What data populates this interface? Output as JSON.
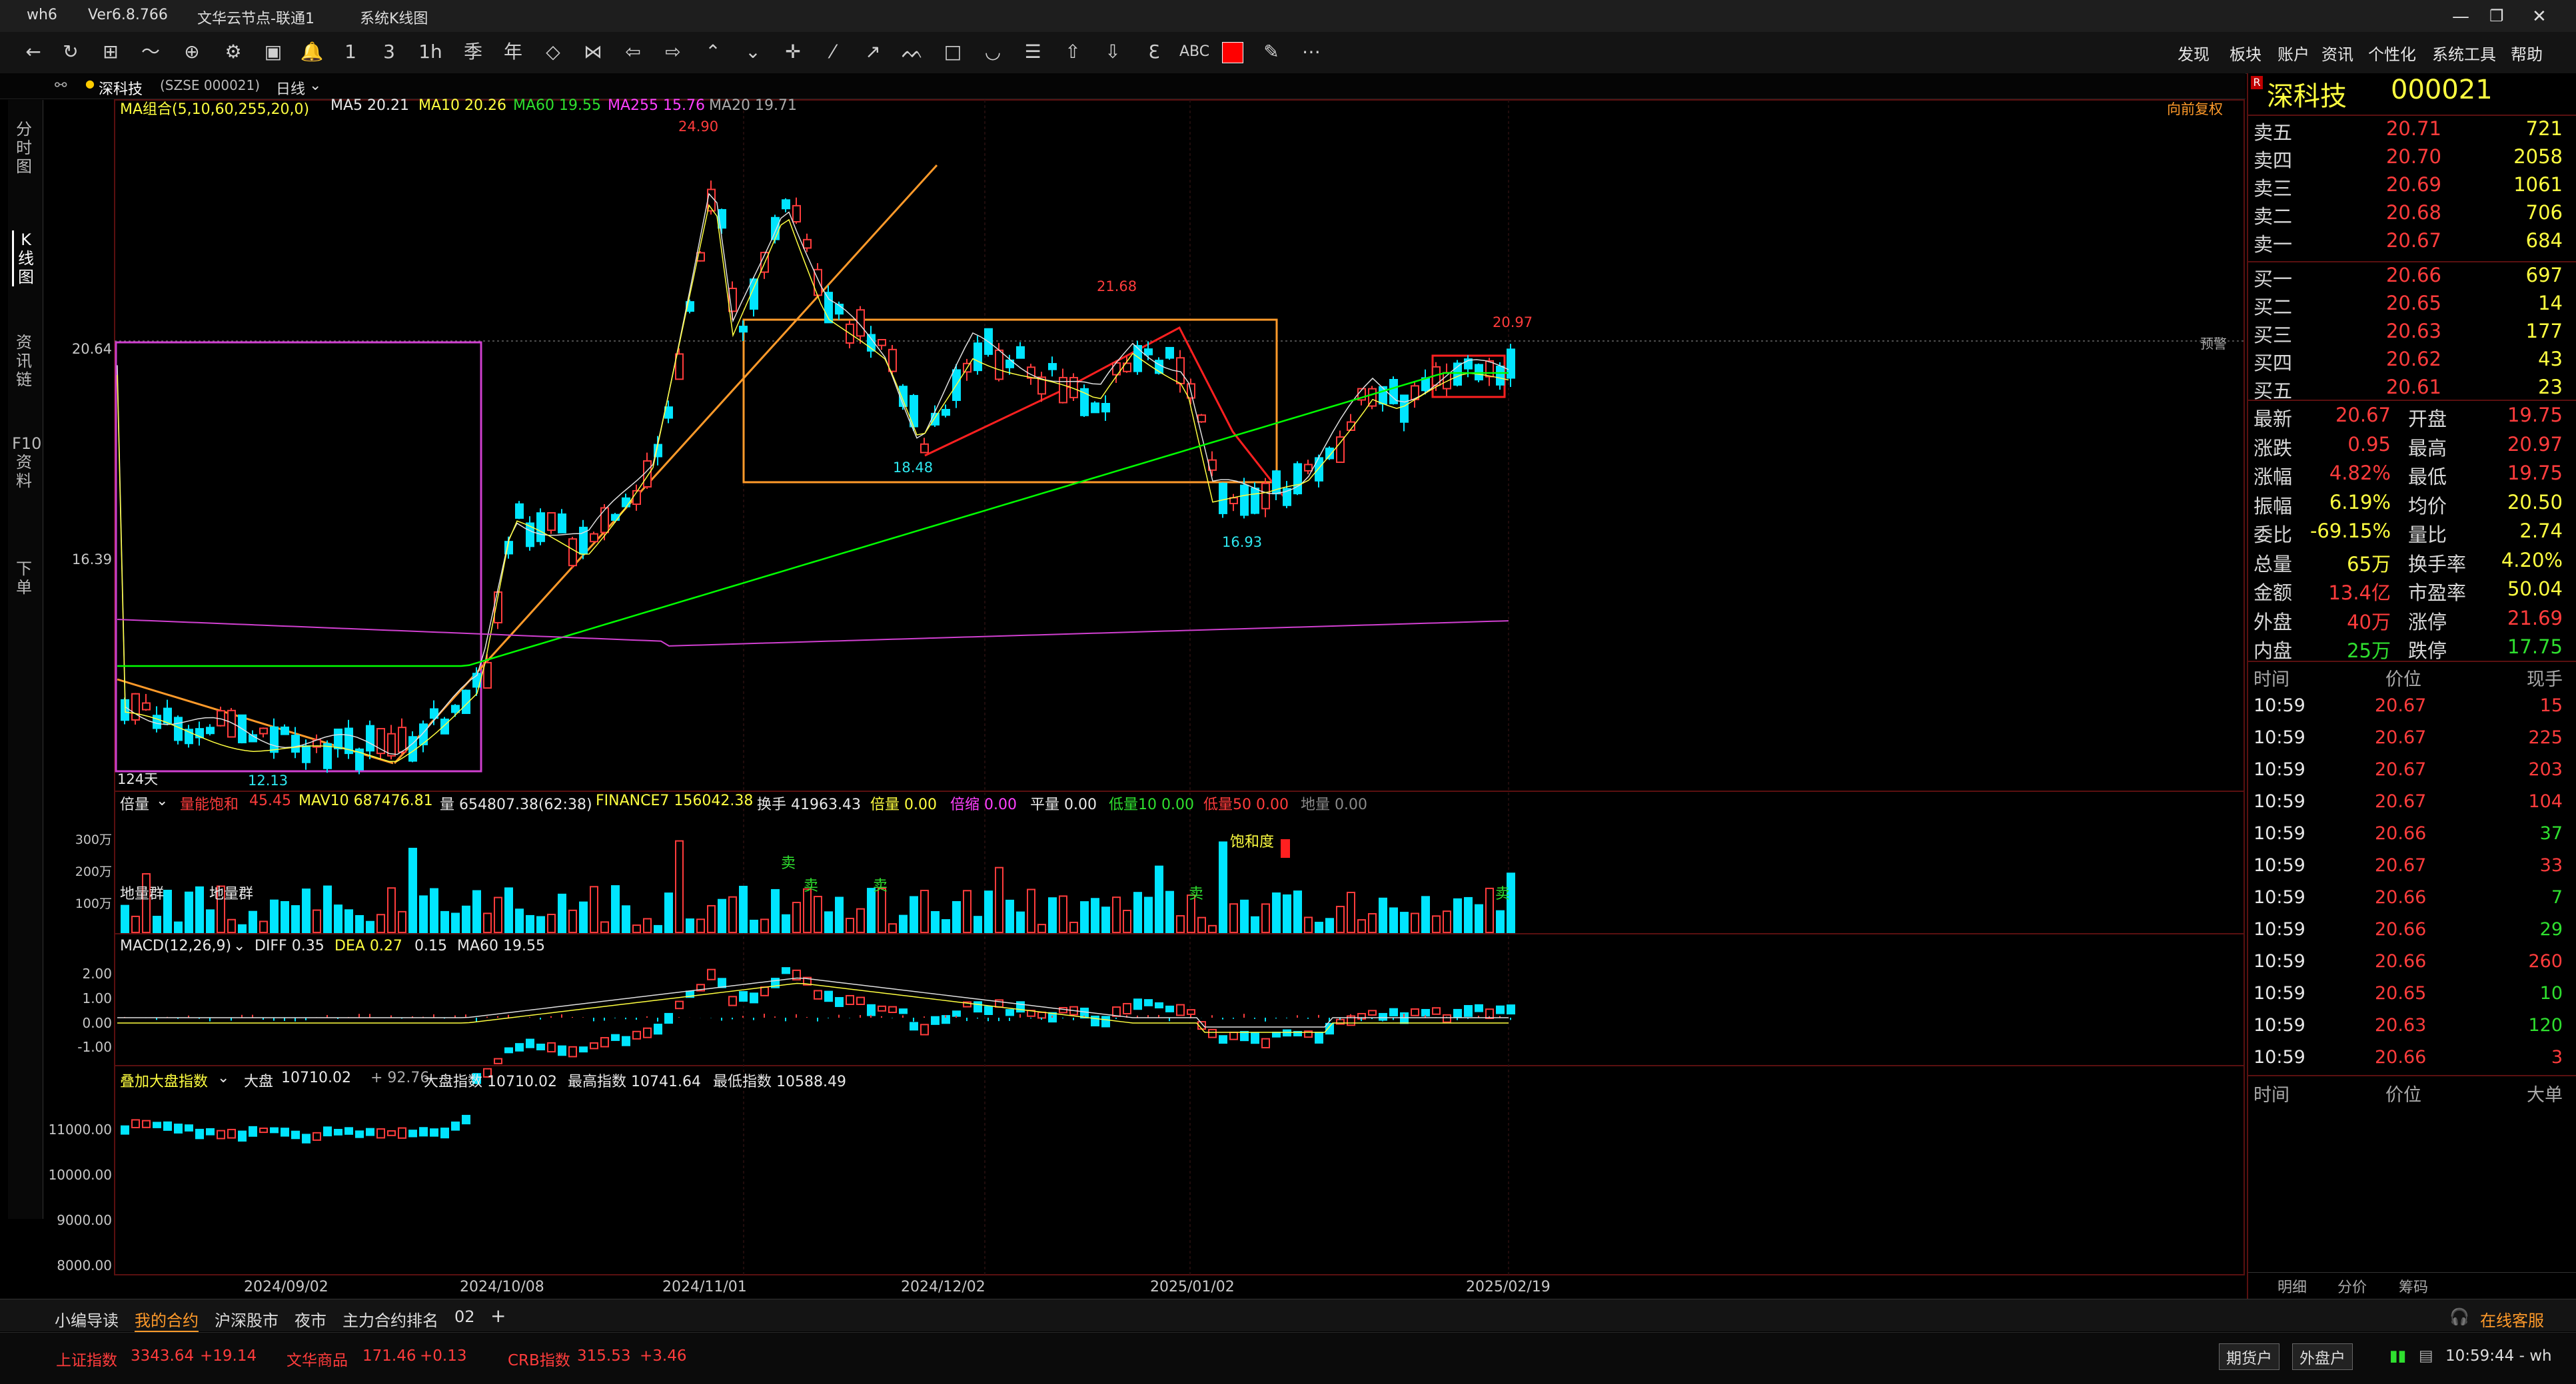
{
  "titlebar": {
    "app": "wh6",
    "version": "Ver6.8.766",
    "server": "文华云节点-联通1",
    "view": "系统K线图"
  },
  "menus": [
    "发现",
    "板块",
    "账户",
    "资讯",
    "个性化",
    "系统工具",
    "帮助"
  ],
  "infobar": {
    "name": "深科技",
    "code": "(SZSE 000021)",
    "period": "日线"
  },
  "left_tabs": [
    "分时图",
    "K线图",
    "资讯链",
    "F10资料",
    "下单"
  ],
  "ma_line": {
    "title": "MA组合(5,10,60,255,20,0)",
    "ma5": "MA5 20.21",
    "ma10": "MA10 20.26",
    "ma60": "MA60 19.55",
    "ma255": "MA255 15.76",
    "ma20": "MA20 19.71",
    "restore": "向前复权"
  },
  "price_labels": {
    "high": "24.90",
    "p2168": "21.68",
    "p2097": "20.97",
    "p1848": "18.48",
    "p1693": "16.93",
    "p1213": "12.13",
    "days": "124天",
    "y1": "20.64",
    "y2": "16.39",
    "warn": "预警"
  },
  "vol_line": {
    "title": "倍量",
    "vp": "量能饱和",
    "vp_val": "45.45",
    "mav": "MAV10 687476.81",
    "vol": "量 654807.38(62:38)",
    "fin": "FINANCE7 156042.38",
    "hs": "换手 41963.43",
    "bl": "倍量 0.00",
    "bs": "倍缩 0.00",
    "pl": "平量 0.00",
    "dl10": "低量10 0.00",
    "dl50": "低量50 0.00",
    "dil": "地量 0.00",
    "t1": "300万",
    "t2": "200万",
    "t3": "100万",
    "dlq1": "地量群",
    "dlq2": "地量群",
    "sell": "卖",
    "bhd": "饱和度"
  },
  "macd_line": {
    "title": "MACD(12,26,9)",
    "diff": "DIFF 0.35",
    "dea": "DEA 0.27",
    "val": "0.15",
    "ma60": "MA60 19.55",
    "t1": "2.00",
    "t2": "1.00",
    "t3": "0.00",
    "t4": "-1.00"
  },
  "idx_line": {
    "title": "叠加大盘指数",
    "dp": "大盘",
    "dp_val": "10710.02",
    "chg": "+ 92.76",
    "dpzs": "大盘指数 10710.02",
    "high": "最高指数 10741.64",
    "low": "最低指数 10588.49",
    "t1": "11000.00",
    "t2": "10000.00",
    "t3": "9000.00",
    "t4": "8000.00"
  },
  "dates": [
    "2024/09/02",
    "2024/10/08",
    "2024/11/01",
    "2024/12/02",
    "2025/01/02",
    "2025/02/19"
  ],
  "quote": {
    "name": "深科技",
    "code": "000021",
    "asks": [
      [
        "卖五",
        "20.71",
        "721"
      ],
      [
        "卖四",
        "20.70",
        "2058"
      ],
      [
        "卖三",
        "20.69",
        "1061"
      ],
      [
        "卖二",
        "20.68",
        "706"
      ],
      [
        "卖一",
        "20.67",
        "684"
      ]
    ],
    "bids": [
      [
        "买一",
        "20.66",
        "697"
      ],
      [
        "买二",
        "20.65",
        "14"
      ],
      [
        "买三",
        "20.63",
        "177"
      ],
      [
        "买四",
        "20.62",
        "43"
      ],
      [
        "买五",
        "20.61",
        "23"
      ]
    ],
    "stats": [
      [
        "最新",
        "20.67",
        "开盘",
        "19.75"
      ],
      [
        "涨跌",
        "0.95",
        "最高",
        "20.97"
      ],
      [
        "涨幅",
        "4.82%",
        "最低",
        "19.75"
      ],
      [
        "振幅",
        "6.19%",
        "均价",
        "20.50"
      ],
      [
        "委比",
        "-69.15%",
        "量比",
        "2.74"
      ],
      [
        "总量",
        "65万",
        "换手率",
        "4.20%"
      ],
      [
        "金额",
        "13.4亿",
        "市盈率",
        "50.04"
      ],
      [
        "外盘",
        "40万",
        "涨停",
        "21.69"
      ],
      [
        "内盘",
        "25万",
        "跌停",
        "17.75"
      ]
    ],
    "tick_headers": [
      "时间",
      "价位",
      "现手"
    ],
    "ticks": [
      [
        "10:59",
        "20.67",
        "15"
      ],
      [
        "10:59",
        "20.67",
        "225"
      ],
      [
        "10:59",
        "20.67",
        "203"
      ],
      [
        "10:59",
        "20.67",
        "104"
      ],
      [
        "10:59",
        "20.66",
        "37"
      ],
      [
        "10:59",
        "20.67",
        "33"
      ],
      [
        "10:59",
        "20.66",
        "7"
      ],
      [
        "10:59",
        "20.66",
        "29"
      ],
      [
        "10:59",
        "20.66",
        "260"
      ],
      [
        "10:59",
        "20.65",
        "10"
      ],
      [
        "10:59",
        "20.63",
        "120"
      ],
      [
        "10:59",
        "20.66",
        "3"
      ]
    ],
    "big_headers": [
      "时间",
      "价位",
      "大单"
    ],
    "bottom_tabs": [
      "明细",
      "分价",
      "筹码"
    ]
  },
  "bottom_tabs": [
    "小编导读",
    "我的合约",
    "沪深股市",
    "夜市",
    "主力合约排名",
    "02",
    "+"
  ],
  "service": "在线客服",
  "status": {
    "sh": "上证指数",
    "sh_val": "3343.64",
    "sh_chg": "+19.14",
    "wh": "文华商品",
    "wh_val": "171.46",
    "wh_chg": "+0.13",
    "crb": "CRB指数",
    "crb_val": "315.53",
    "crb_chg": "+3.46",
    "acct1": "期货户",
    "acct2": "外盘户",
    "time": "10:59:44 - wh"
  },
  "colors": {
    "up": "#ff3c3c",
    "down": "#00e5ff",
    "ma5": "#ffffff",
    "ma10": "#ffff00",
    "ma60": "#00ff00",
    "ma255": "#ff40ff",
    "box": "#ff9a2a"
  }
}
